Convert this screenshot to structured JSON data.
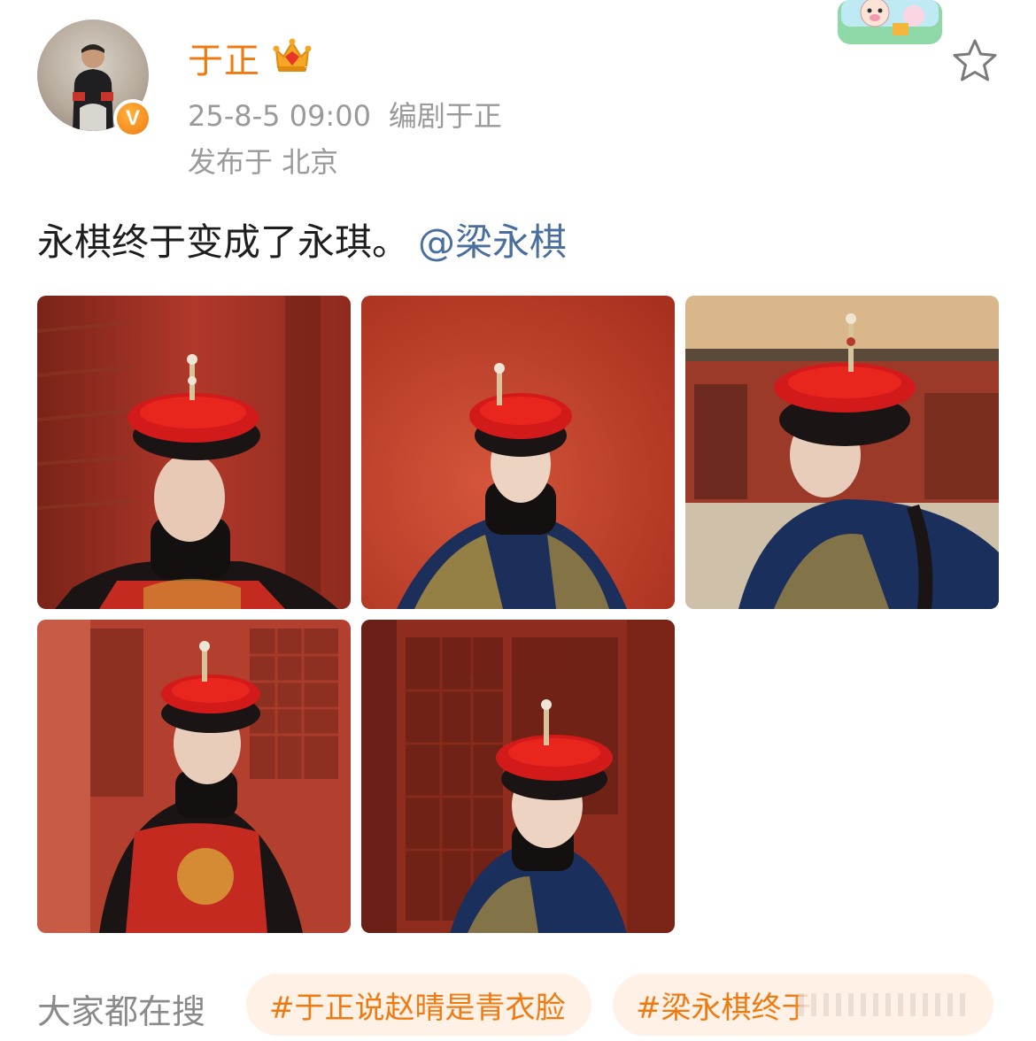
{
  "post": {
    "user": {
      "name": "于正",
      "verified_badge": "V"
    },
    "time": "25-8-5 09:00",
    "source": "编剧于正",
    "location": "发布于 北京",
    "text": "永棋终于变成了永琪。",
    "mention": "@梁永棋",
    "photos": [
      {
        "icon": "photo"
      },
      {
        "icon": "photo"
      },
      {
        "icon": "photo"
      },
      {
        "icon": "photo"
      },
      {
        "icon": "photo"
      }
    ]
  },
  "trending": {
    "label": "大家都在搜",
    "chips": [
      "#于正说赵晴是青衣脸",
      "#梁永棋终于"
    ]
  },
  "colors": {
    "accent": "#f07a12",
    "mention": "#4a6f9e",
    "meta": "#9a9a9a",
    "chip_bg": "#fff1e6"
  }
}
